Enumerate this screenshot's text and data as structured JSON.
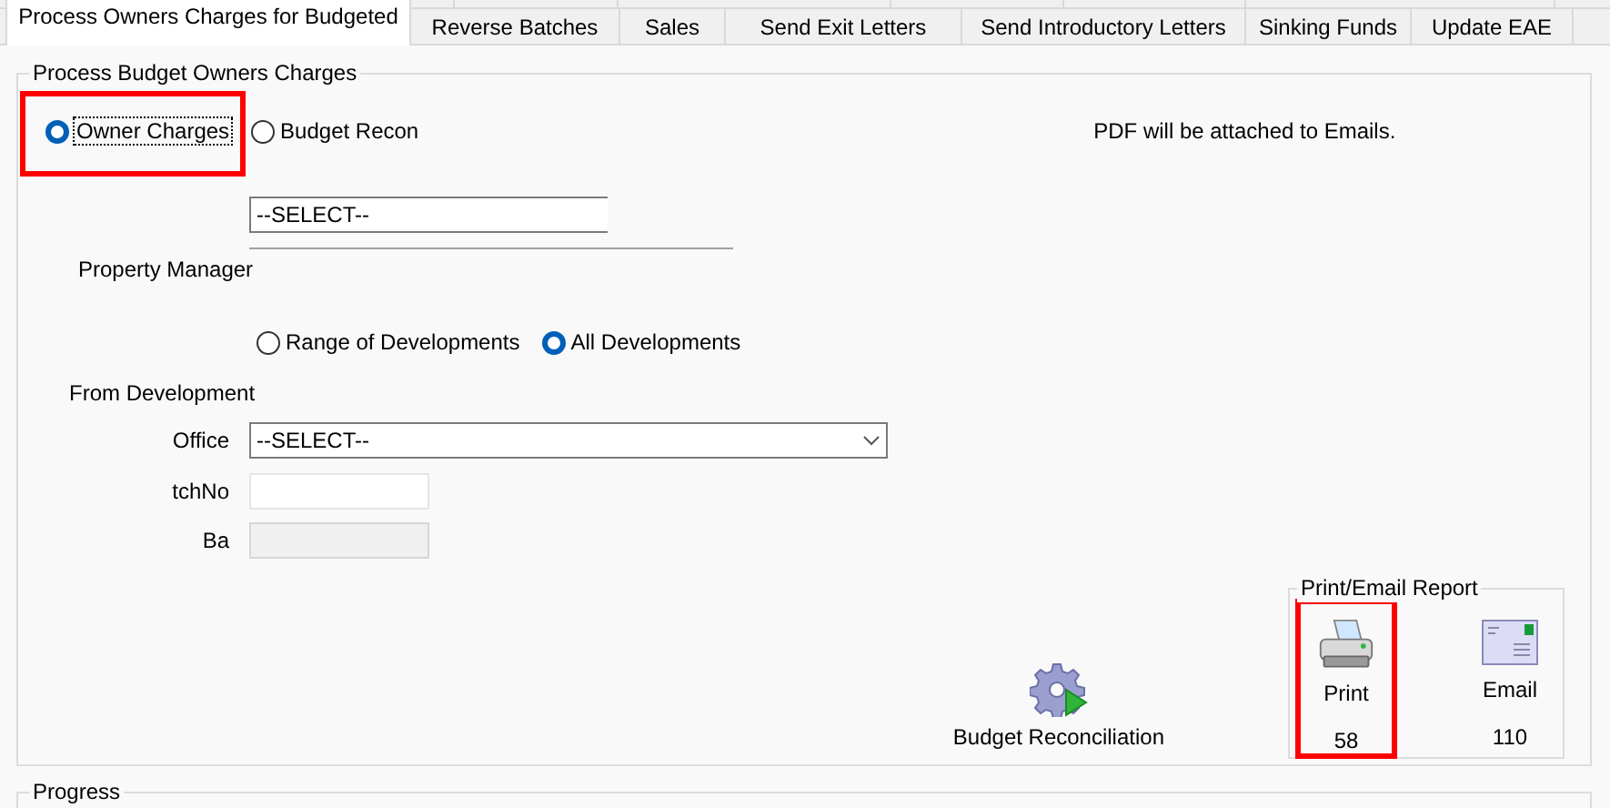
{
  "tabs": [
    {
      "label": "Process Owners Charges for Budgeted",
      "selected": true
    },
    {
      "label": "Reverse  Batches",
      "selected": false
    },
    {
      "label": "Sales",
      "selected": false
    },
    {
      "label": "Send Exit Letters",
      "selected": false
    },
    {
      "label": "Send Introductory Letters",
      "selected": false
    },
    {
      "label": "Sinking Funds",
      "selected": false
    },
    {
      "label": "Update EAE",
      "selected": false
    }
  ],
  "group": {
    "title": "Process Budget Owners Charges",
    "mode_options": [
      {
        "label": "Owner Charges",
        "selected": true,
        "highlighted": true
      },
      {
        "label": "Budget Recon",
        "selected": false,
        "highlighted": false
      }
    ],
    "note": "PDF will be attached to Emails.",
    "property_manager": {
      "label": "Property Manager",
      "value": "--SELECT--"
    },
    "development_options": [
      {
        "label": "Range of Developments",
        "selected": false
      },
      {
        "label": "All Developments",
        "selected": true
      }
    ],
    "from_development_label": "From Development",
    "office": {
      "label": "Office",
      "value": "--SELECT--"
    },
    "batch_no": {
      "label": "tchNo",
      "disabled": false
    },
    "field_3": {
      "label": "Ba",
      "disabled": true
    },
    "reconcile_button": {
      "label": "Budget Reconciliation"
    },
    "report_group": {
      "title": "Print/Email Report",
      "buttons": [
        {
          "kind": "print",
          "label": "Print",
          "count": "58",
          "highlighted": true
        },
        {
          "kind": "email",
          "label": "Email",
          "count": "110",
          "highlighted": false
        }
      ]
    }
  },
  "progress_group": {
    "title": "Progress"
  }
}
